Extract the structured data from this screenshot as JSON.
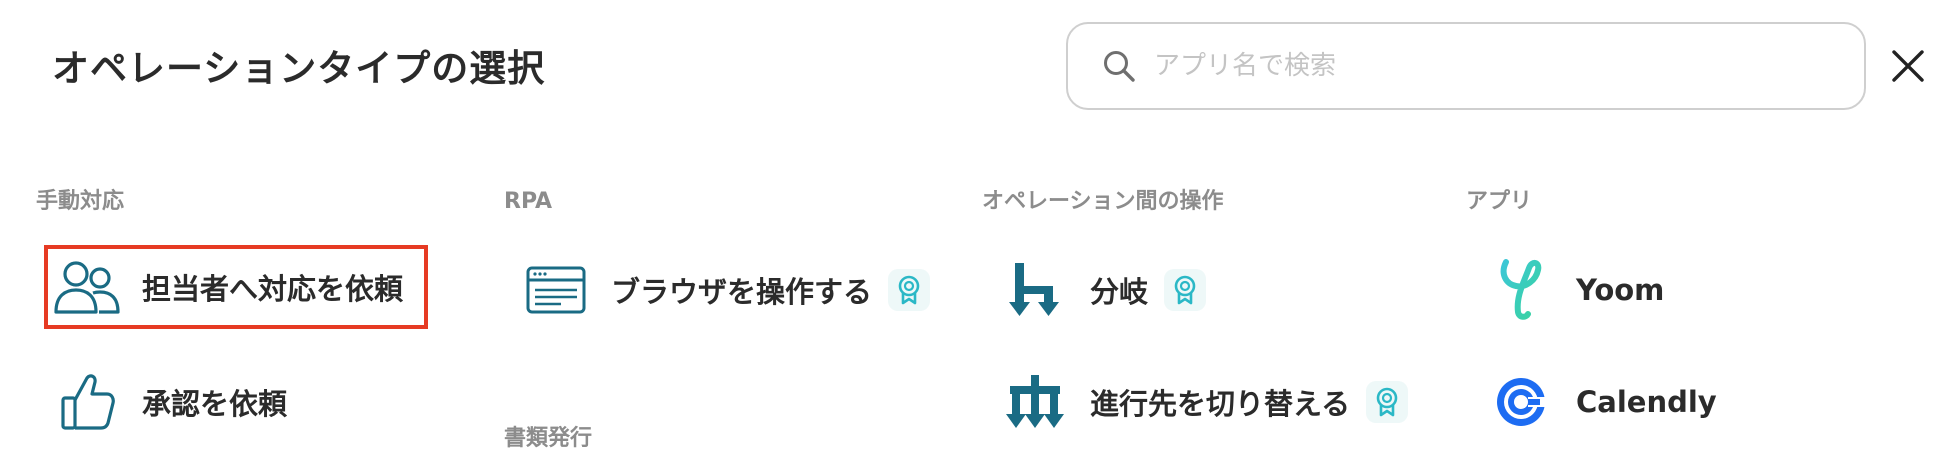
{
  "modal": {
    "title": "オペレーションタイプの選択",
    "search_placeholder": "アプリ名で検索"
  },
  "categories": {
    "manual": "手動対応",
    "rpa": "RPA",
    "between": "オペレーション間の操作",
    "apps": "アプリ",
    "documents": "書類発行"
  },
  "items": {
    "assign_request": "担当者へ対応を依頼",
    "approval_request": "承認を依頼",
    "browser_operation": "ブラウザを操作する",
    "branch": "分岐",
    "switch_path": "進行先を切り替える",
    "yoom": "Yoom",
    "calendly": "Calendly"
  },
  "colors": {
    "accent_teal": "#1a6b84",
    "badge_teal": "#2bb8c6",
    "selection_red": "#e63a23",
    "calendly_blue": "#1d6cf2",
    "yoom_cyan": "#3cc7d6"
  },
  "icons": {
    "search": "search-icon",
    "close": "close-icon",
    "users": "users-icon",
    "thumbs_up": "thumbs-up-icon",
    "browser": "browser-window-icon",
    "branch": "branch-icon",
    "switch": "switch-path-icon",
    "premium": "premium-badge-icon",
    "yoom": "yoom-logo-icon",
    "calendly": "calendly-logo-icon"
  }
}
